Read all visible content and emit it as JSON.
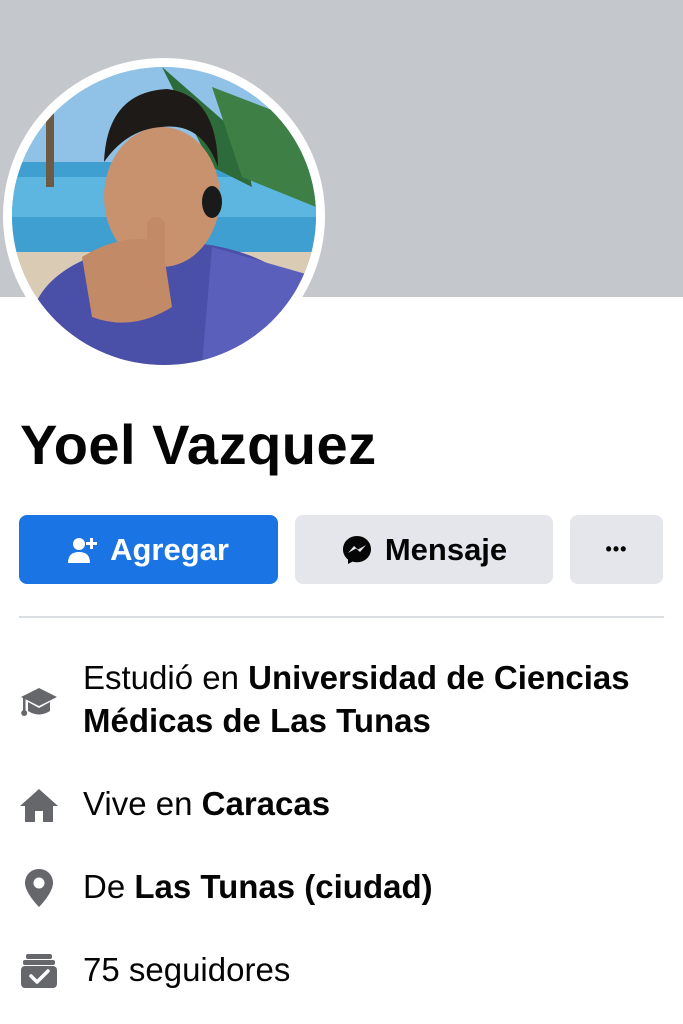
{
  "profile": {
    "name": "Yoel Vazquez"
  },
  "actions": {
    "add_label": "Agregar",
    "message_label": "Mensaje",
    "more_label": "•••"
  },
  "intro": {
    "education": {
      "prefix": "Estudió en",
      "value": "Universidad de Ciencias Médicas de Las Tunas",
      "icon": "graduation-cap-icon"
    },
    "lives": {
      "prefix": "Vive en",
      "value": "Caracas",
      "icon": "home-icon"
    },
    "from": {
      "prefix": "De",
      "value": "Las Tunas (ciudad)",
      "icon": "location-pin-icon"
    },
    "followers": {
      "text": "75 seguidores",
      "icon": "followers-icon"
    }
  },
  "colors": {
    "primary": "#1b74e4",
    "secondary_button": "#e4e6eb",
    "cover": "#c4c7cc",
    "icon": "#65676b"
  }
}
